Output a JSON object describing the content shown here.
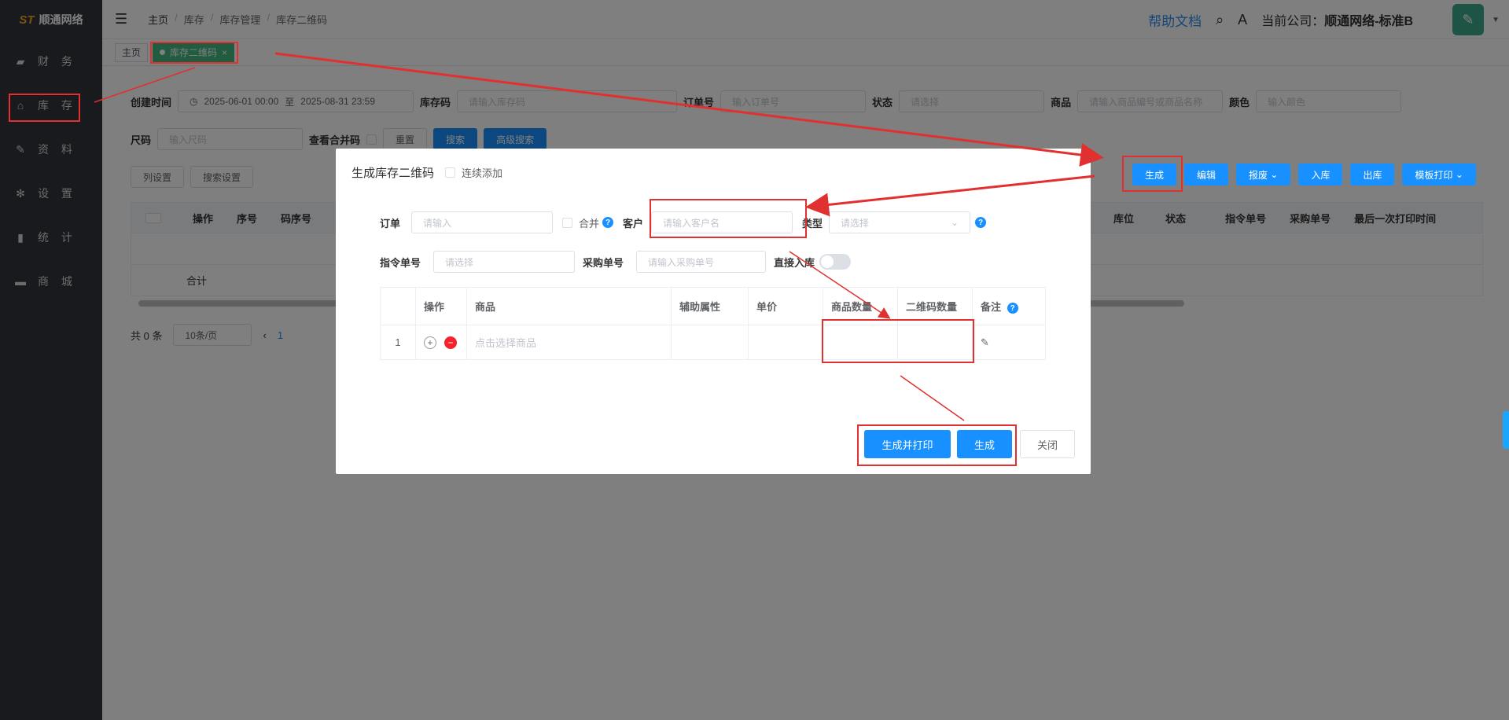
{
  "sidebar": {
    "logo_text": "顺通网络",
    "logo_mark": "ST",
    "items": [
      {
        "label": "财 务",
        "icon": "bag-icon"
      },
      {
        "label": "库 存",
        "icon": "home-icon"
      },
      {
        "label": "资 料",
        "icon": "edit-icon"
      },
      {
        "label": "设 置",
        "icon": "gear-icon"
      },
      {
        "label": "统 计",
        "icon": "bar-chart-icon"
      },
      {
        "label": "商 城",
        "icon": "shop-icon"
      }
    ]
  },
  "header": {
    "breadcrumb": [
      "主页",
      "库存",
      "库存管理",
      "库存二维码"
    ],
    "help": "帮助文档",
    "company_prefix": "当前公司：",
    "company_name": "顺通网络-标准B"
  },
  "tags": {
    "home": "主页",
    "active": "库存二维码",
    "close": "×"
  },
  "filters": {
    "created_label": "创建时间",
    "date_start": "2025-06-01 00:00",
    "date_to": "至",
    "date_end": "2025-08-31 23:59",
    "stock_code_label": "库存码",
    "stock_code_ph": "请输入库存码",
    "order_no_label": "订单号",
    "order_no_ph": "输入订单号",
    "status_label": "状态",
    "status_ph": "请选择",
    "goods_label": "商品",
    "goods_ph": "请输入商品编号或商品名称",
    "color_label": "颜色",
    "color_ph": "输入颜色",
    "size_label": "尺码",
    "size_ph": "输入尺码",
    "merge_label": "查看合并码",
    "reset": "重置",
    "search": "搜索",
    "adv_search": "高级搜索",
    "col_settings": "列设置",
    "search_settings": "搜索设置"
  },
  "actions": {
    "generate": "生成",
    "edit": "编辑",
    "scrap": "报废",
    "stock_in": "入库",
    "stock_out": "出库",
    "template_print": "模板打印"
  },
  "table": {
    "headers": [
      "操作",
      "序号",
      "码序号"
    ],
    "right_headers": [
      "库位",
      "状态",
      "指令单号",
      "采购单号",
      "最后一次打印时间"
    ],
    "sum_label": "合计"
  },
  "pager": {
    "total": "共 0 条",
    "page_size": "10条/页",
    "current": "1"
  },
  "dialog": {
    "title": "生成库存二维码",
    "continuous_add": "连续添加",
    "order_label": "订单",
    "order_ph": "请输入",
    "merge_label": "合并",
    "customer_label": "客户",
    "customer_ph": "请输入客户名",
    "type_label": "类型",
    "type_ph": "请选择",
    "cmd_no_label": "指令单号",
    "cmd_no_ph": "请选择",
    "purchase_no_label": "采购单号",
    "purchase_no_ph": "请输入采购单号",
    "direct_in_label": "直接入库",
    "columns": [
      "操作",
      "商品",
      "辅助属性",
      "单价",
      "商品数量",
      "二维码数量",
      "备注"
    ],
    "row_index": "1",
    "select_goods_ph": "点击选择商品",
    "btn_generate_print": "生成并打印",
    "btn_generate": "生成",
    "btn_close": "关闭"
  },
  "colors": {
    "sidebar_bg": "#30343b",
    "primary": "#1890ff",
    "tag_active": "#42b983",
    "annotation": "#e03030"
  }
}
